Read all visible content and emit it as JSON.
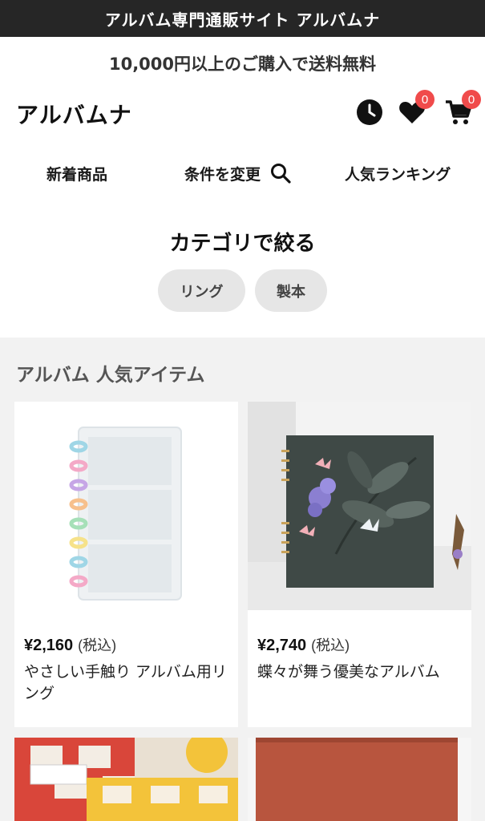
{
  "topbar": {
    "title": "アルバム専門通販サイト アルバムナ"
  },
  "header": {
    "shipping_notice": "10,000円以上のご購入で送料無料",
    "logo": "アルバムナ",
    "favorites_count": "0",
    "cart_count": "0",
    "nav": {
      "new_items": "新着商品",
      "change_conditions": "条件を変更",
      "ranking": "人気ランキング"
    }
  },
  "filter": {
    "title": "カテゴリで絞る",
    "chips": [
      "リング",
      "製本"
    ]
  },
  "section": {
    "title": "アルバム 人気アイテム"
  },
  "products": [
    {
      "price": "¥2,160",
      "tax": "(税込)",
      "name": "やさしい手触り アルバム用リング"
    },
    {
      "price": "¥2,740",
      "tax": "(税込)",
      "name": "蝶々が舞う優美なアルバム"
    }
  ],
  "colors": {
    "topbar_bg": "#262626",
    "badge": "#f04b4b",
    "chip_bg": "#e6e6e6",
    "page_bg": "#f2f2f2"
  },
  "icons": [
    "clock-icon",
    "heart-icon",
    "cart-icon",
    "search-icon"
  ]
}
